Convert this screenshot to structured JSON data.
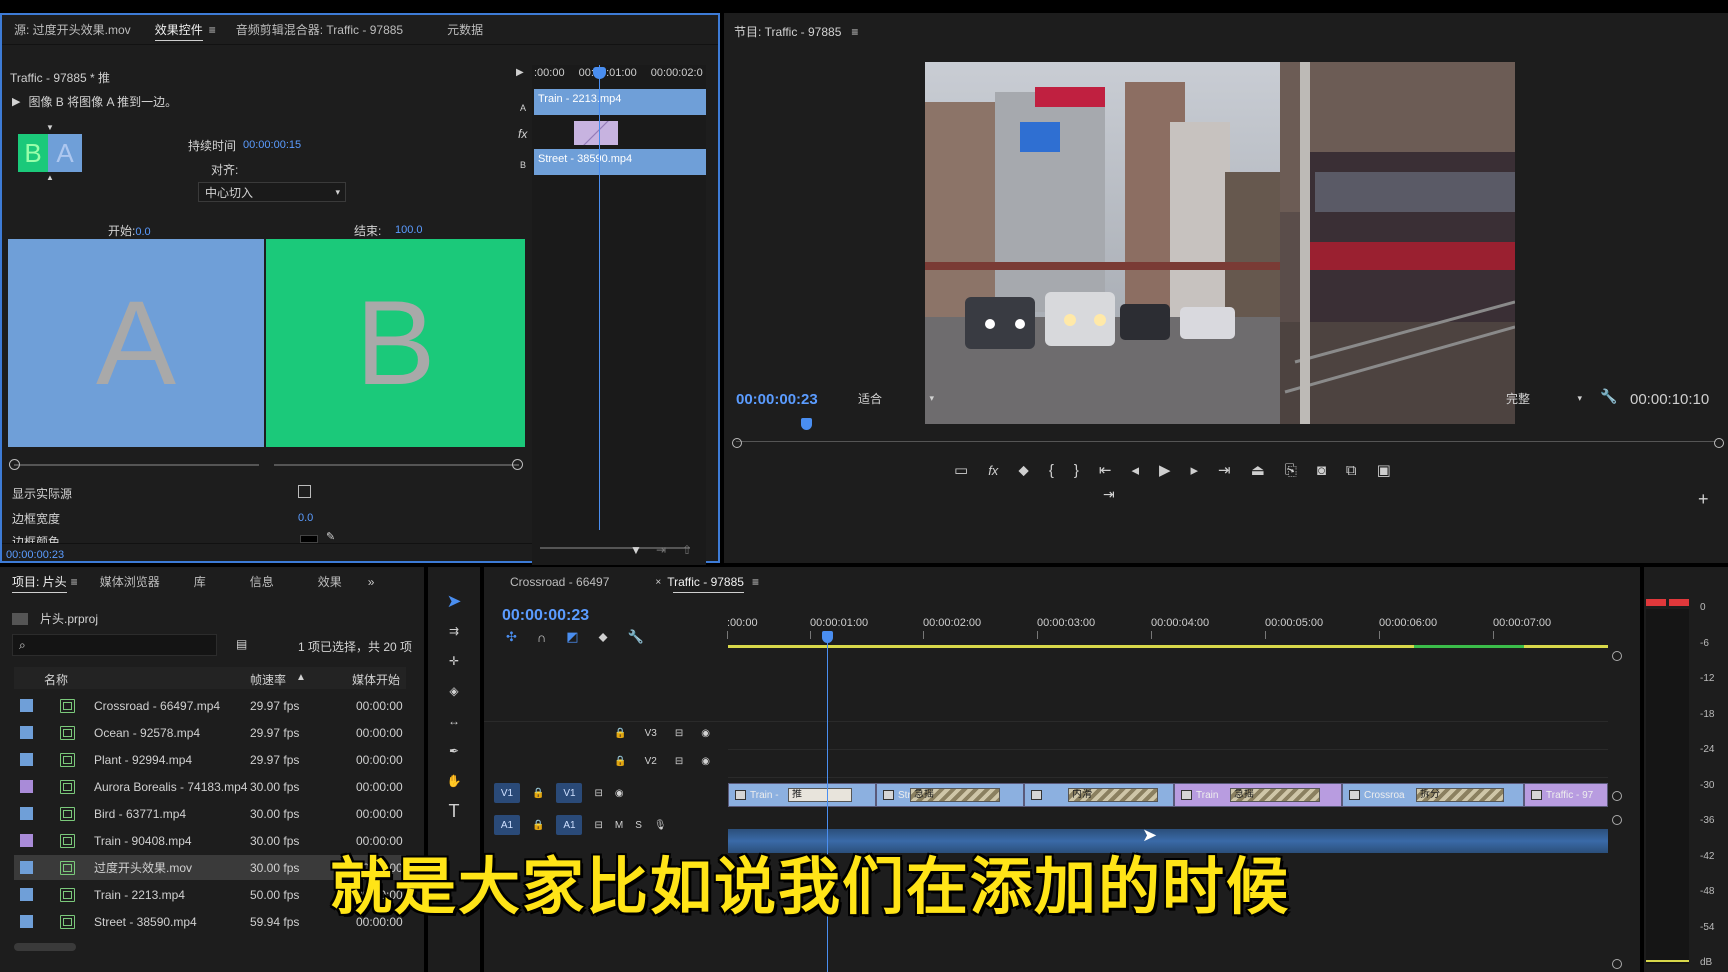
{
  "effect_controls": {
    "tabs": [
      "源: 过度开头效果.mov",
      "效果控件",
      "音频剪辑混合器: Traffic - 97885",
      "元数据"
    ],
    "clip_name": "Traffic - 97885 * 推",
    "description": "图像 B 将图像 A 推到一边。",
    "duration_label": "持续时间",
    "duration_value": "00:00:00:15",
    "align_label": "对齐:",
    "align_value": "中心切入",
    "start_label": "开始:",
    "start_value": "0.0",
    "end_label": "结束:",
    "end_value": "100.0",
    "preview_a": "A",
    "preview_b": "B",
    "thumb_b": "B",
    "thumb_a": "A",
    "show_actual_source": "显示实际源",
    "border_width_label": "边框宽度",
    "border_width_value": "0.0",
    "border_color_label": "边框颜色",
    "timecode": "00:00:00:23",
    "mini_timeline": {
      "ticks": [
        ":00:00",
        "00:00:01:00",
        "00:00:02:0"
      ],
      "clip_a": "Train - 2213.mp4",
      "clip_b": "Street - 38590.mp4",
      "track_a": "A",
      "track_b": "B",
      "fx": "fx"
    }
  },
  "program_monitor": {
    "title": "节目: Traffic - 97885",
    "timecode": "00:00:00:23",
    "fit_label": "适合",
    "quality_label": "完整",
    "duration": "00:00:10:10"
  },
  "project": {
    "tabs": [
      "项目: 片头",
      "媒体浏览器",
      "库",
      "信息",
      "效果"
    ],
    "file": "片头.prproj",
    "selection_info": "1 项已选择，共 20 项",
    "columns": [
      "名称",
      "帧速率",
      "媒体开始"
    ],
    "rows": [
      {
        "name": "Crossroad - 66497.mp4",
        "fps": "29.97 fps",
        "start": "00:00:00",
        "color": "#6f9fd8"
      },
      {
        "name": "Ocean - 92578.mp4",
        "fps": "29.97 fps",
        "start": "00:00:00",
        "color": "#6f9fd8"
      },
      {
        "name": "Plant - 92994.mp4",
        "fps": "29.97 fps",
        "start": "00:00:00",
        "color": "#6f9fd8"
      },
      {
        "name": "Aurora Borealis - 74183.mp4",
        "fps": "30.00 fps",
        "start": "00:00:00",
        "color": "#a98bd8"
      },
      {
        "name": "Bird - 63771.mp4",
        "fps": "30.00 fps",
        "start": "00:00:00",
        "color": "#6f9fd8"
      },
      {
        "name": "Train - 90408.mp4",
        "fps": "30.00 fps",
        "start": "00:00:00",
        "color": "#a98bd8"
      },
      {
        "name": "过度开头效果.mov",
        "fps": "30.00 fps",
        "start": "00:00:00",
        "color": "#6f9fd8"
      },
      {
        "name": "Train - 2213.mp4",
        "fps": "50.00 fps",
        "start": "00:00:00",
        "color": "#6f9fd8"
      },
      {
        "name": "Street - 38590.mp4",
        "fps": "59.94 fps",
        "start": "00:00:00",
        "color": "#6f9fd8"
      }
    ]
  },
  "timeline": {
    "tabs": [
      "Crossroad - 66497",
      "Traffic - 97885"
    ],
    "timecode": "00:00:00:23",
    "ruler": [
      ":00:00",
      "00:00:01:00",
      "00:00:02:00",
      "00:00:03:00",
      "00:00:04:00",
      "00:00:05:00",
      "00:00:06:00",
      "00:00:07:00"
    ],
    "tracks": {
      "v3": "V3",
      "v2": "V2",
      "v1": "V1",
      "a1": "A1",
      "m": "M",
      "s": "S"
    },
    "clips": [
      "Train -",
      "Stree",
      "Train",
      "Crossroa",
      "Traffic - 97"
    ],
    "transitions": [
      "推",
      "急摇",
      "内滑",
      "急摇",
      "拆分"
    ]
  },
  "meter_scale": [
    "0",
    "-6",
    "-12",
    "-18",
    "-24",
    "-30",
    "-36",
    "-42",
    "-48",
    "-54",
    "dB"
  ],
  "subtitle": "就是大家比如说我们在添加的时候"
}
